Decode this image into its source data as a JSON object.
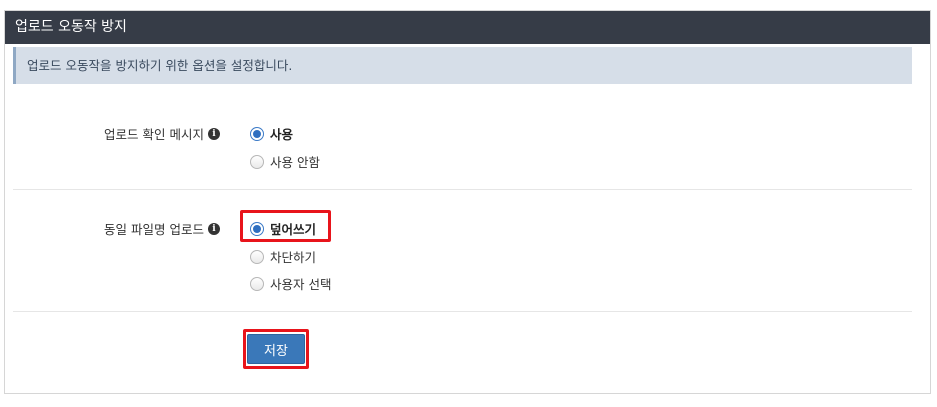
{
  "panel": {
    "title": "업로드 오동작 방지"
  },
  "info_message": "업로드 오동작을 방지하기 위한 옵션을 설정합니다.",
  "upload_confirm": {
    "label": "업로드 확인 메시지",
    "info_icon": "info-circle-icon",
    "options": [
      {
        "label": "사용",
        "checked": true
      },
      {
        "label": "사용 안함",
        "checked": false
      }
    ]
  },
  "duplicate_filename": {
    "label": "동일 파일명 업로드",
    "info_icon": "info-circle-icon",
    "options": [
      {
        "label": "덮어쓰기",
        "checked": true
      },
      {
        "label": "차단하기",
        "checked": false
      },
      {
        "label": "사용자 선택",
        "checked": false
      }
    ]
  },
  "actions": {
    "save_label": "저장"
  },
  "colors": {
    "header_bg": "#363c47",
    "info_bg": "#d6dee8",
    "accent": "#3a78b9",
    "highlight": "#e8141b"
  }
}
